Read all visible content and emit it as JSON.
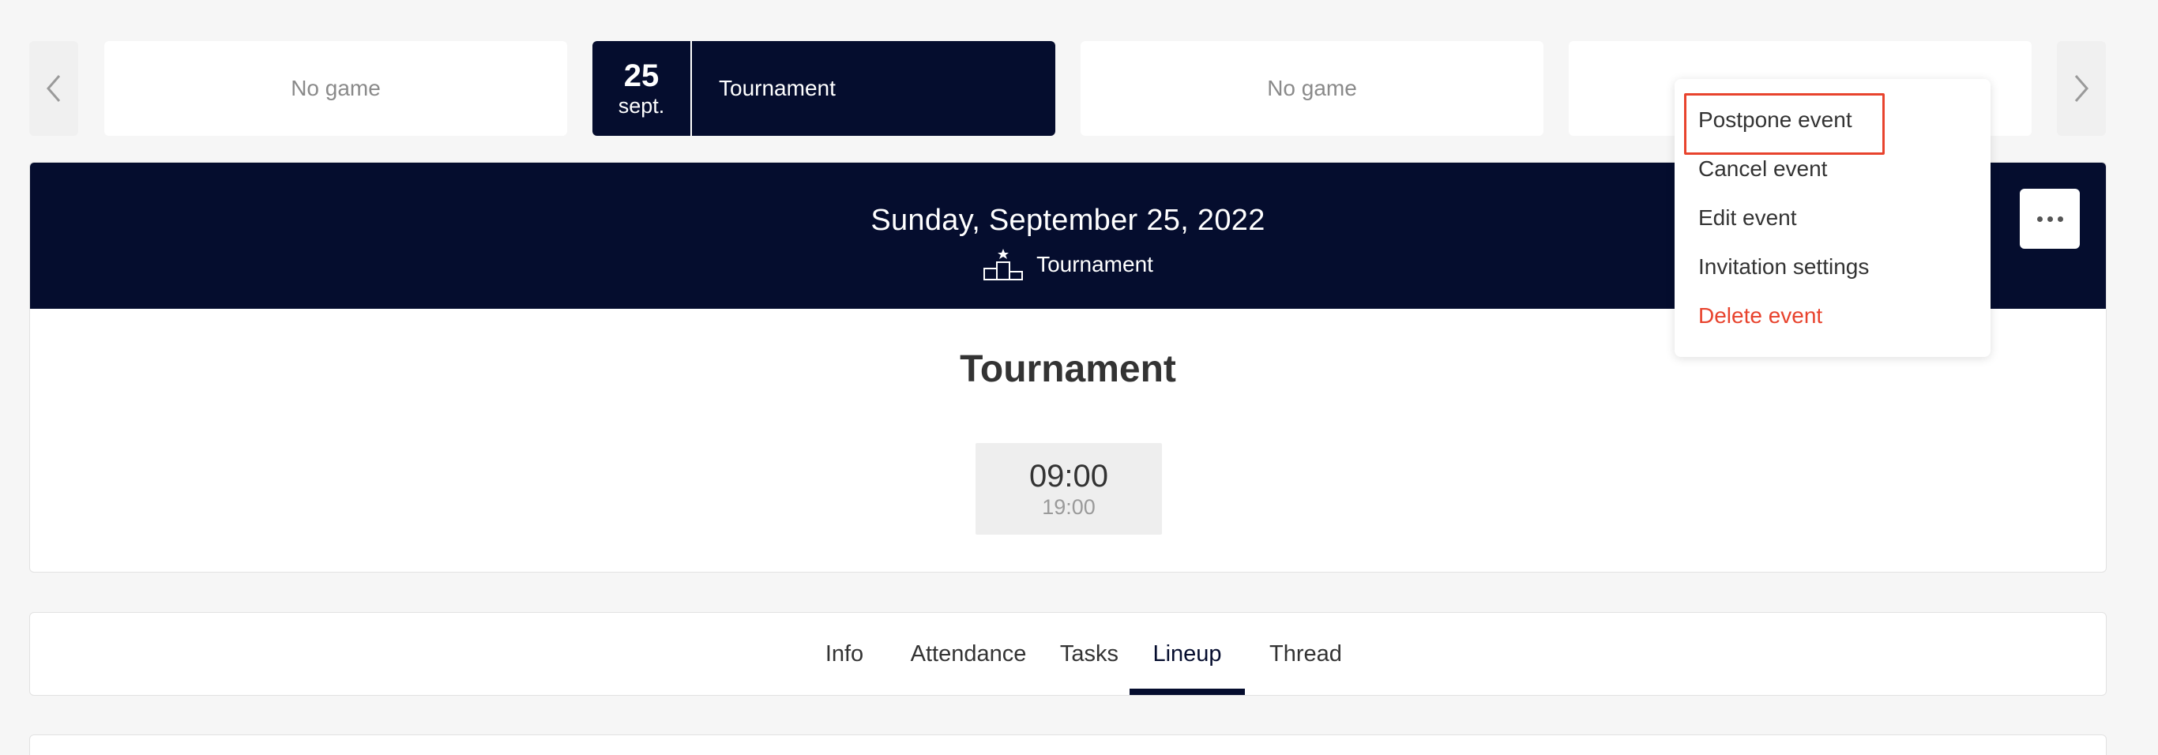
{
  "carousel": {
    "prev_icon": "chevron-left-icon",
    "next_icon": "chevron-right-icon",
    "slots": [
      {
        "label": "No game"
      },
      {
        "day": "25",
        "month": "sept.",
        "label": "Tournament"
      },
      {
        "label": "No game"
      },
      {
        "label": ""
      }
    ]
  },
  "event": {
    "date": "Sunday, September 25, 2022",
    "type_icon": "podium-icon",
    "type": "Tournament",
    "title": "Tournament",
    "time_start": "09:00",
    "time_end": "19:00",
    "more_icon": "more-horizontal-icon"
  },
  "menu": {
    "items": [
      {
        "label": "Postpone event"
      },
      {
        "label": "Cancel event"
      },
      {
        "label": "Edit event"
      },
      {
        "label": "Invitation settings"
      },
      {
        "label": "Delete event",
        "color": "#e8432d"
      }
    ],
    "highlighted": "Postpone event"
  },
  "tabs": {
    "items": [
      {
        "label": "Info"
      },
      {
        "label": "Attendance"
      },
      {
        "label": "Tasks"
      },
      {
        "label": "Lineup"
      },
      {
        "label": "Thread"
      }
    ],
    "active": "Lineup"
  },
  "colors": {
    "navy": "#050d2e",
    "danger": "#e8432d",
    "background": "#f6f6f6"
  }
}
